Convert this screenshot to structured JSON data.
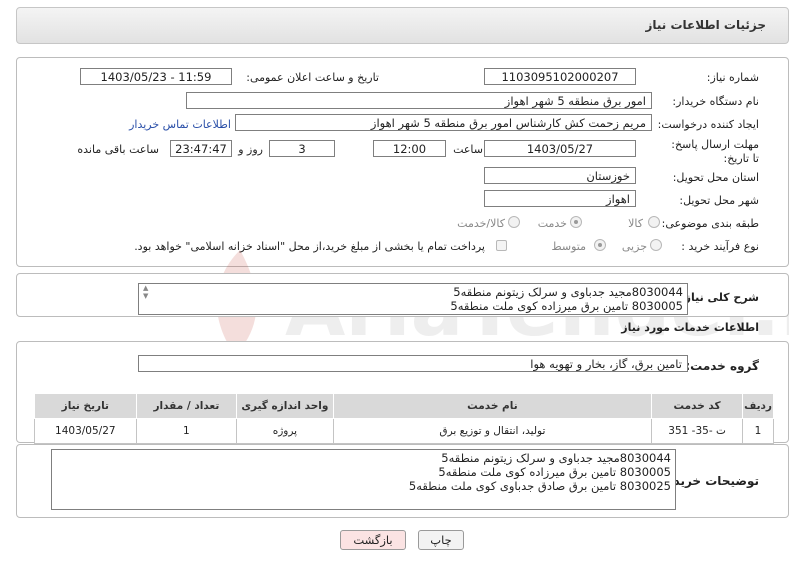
{
  "header": {
    "title": "جزئیات اطلاعات نیاز"
  },
  "fields": {
    "need_number_label": "شماره نیاز:",
    "need_number": "1103095102000207",
    "announce_label": "تاریخ و ساعت اعلان عمومی:",
    "announce_value": "1403/05/23 - 11:59",
    "buyer_org_label": "نام دستگاه خریدار:",
    "buyer_org": "امور برق منطقه 5 شهر اهواز",
    "requester_label": "ایجاد کننده درخواست:",
    "requester": "مریم زحمت کش کارشناس امور برق منطقه 5 شهر اهواز",
    "contact_link": "اطلاعات تماس خریدار",
    "deadline_label": "مهلت ارسال پاسخ: تا تاریخ:",
    "deadline_date": "1403/05/27",
    "hour_label": "ساعت",
    "deadline_time": "12:00",
    "days_value": "3",
    "day_and_label": "روز و",
    "remaining_time": "23:47:47",
    "remaining_label": "ساعت باقی مانده",
    "province_label": "استان محل تحویل:",
    "province": "خوزستان",
    "city_label": "شهر محل تحویل:",
    "city": "اهواز",
    "category_label": "طبقه بندی موضوعی:",
    "category_options": [
      "کالا",
      "خدمت",
      "کالا/خدمت"
    ],
    "process_label": "نوع فرآیند خرید :",
    "process_options": [
      "جزیی",
      "متوسط"
    ],
    "payment_text": "پرداخت تمام یا بخشی از مبلغ خرید،از محل \"اسناد خزانه اسلامی\" خواهد بود."
  },
  "summary": {
    "label": "شرح کلی نیاز:",
    "text": "8030044مجید جدباوی و سرلک زیتونم منطقه5\n8030005 تامین برق میرزاده کوی ملت منطقه5"
  },
  "services": {
    "section_title": "اطلاعات خدمات مورد نیاز",
    "group_label": "گروه خدمت:",
    "group_value": "تامین برق، گاز، بخار و تهویه هوا",
    "table": {
      "headers": [
        "ردیف",
        "کد خدمت",
        "نام خدمت",
        "واحد اندازه گیری",
        "تعداد / مقدار",
        "تاریخ نیاز"
      ],
      "rows": [
        [
          "1",
          "ت -35- 351",
          "تولید، انتقال و توزیع برق",
          "پروژه",
          "1",
          "1403/05/27"
        ]
      ]
    }
  },
  "buyer_notes": {
    "label": "توضیحات خریدار:",
    "text": "8030044مجید جدباوی و سرلک زیتونم منطقه5\n8030005 تامین برق میرزاده کوی ملت منطقه5\n8030025 تامین برق صادق جدباوی کوی ملت منطقه5"
  },
  "buttons": {
    "print": "چاپ",
    "back": "بازگشت"
  },
  "watermark": {
    "text": "AriaTender.neT"
  },
  "colors": {
    "link": "#2a4fa8",
    "back_button_bg": "#fbe3e3",
    "watermark": "#c0392b"
  }
}
